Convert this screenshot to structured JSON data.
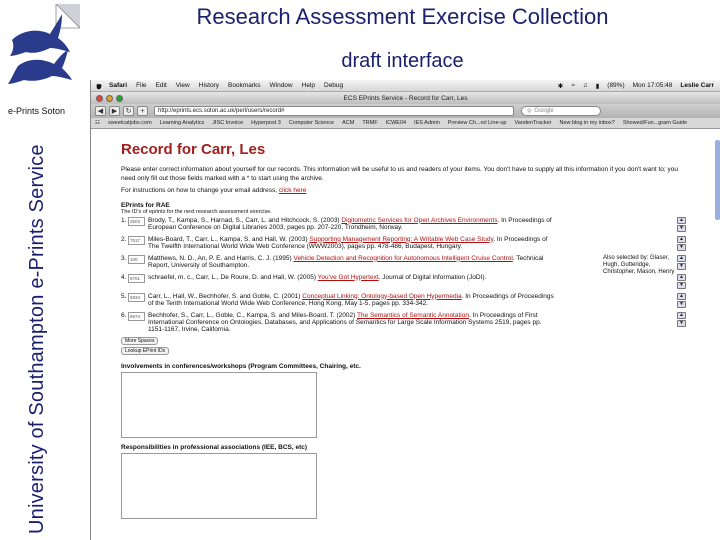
{
  "slide": {
    "title": "Research Assessment Exercise Collection",
    "subtitle": "draft interface",
    "brand_label": "e-Prints Soton",
    "vertical_text": "University of Southampton e-Prints Service"
  },
  "colors": {
    "title": "#1a1f6e",
    "record_heading": "#a0201e",
    "link": "#b01010"
  },
  "menubar": {
    "menus": [
      "Safari",
      "File",
      "Edit",
      "View",
      "History",
      "Bookmarks",
      "Window",
      "Help",
      "Debug"
    ],
    "battery": "(89%)",
    "clock": "Mon 17:05:48",
    "user": "Leslie Carr"
  },
  "browser": {
    "window_title": "ECS EPrints Service - Record for Carr, Les",
    "url": "http://eprints.ecs.soton.ac.uk/perl/users/record#",
    "search_placeholder": "Google",
    "bookmarks": [
      "sweetcatjobs.com",
      "Learning Analytics",
      "JISC Invoice",
      "Hyperpost 3",
      "Computer Science",
      "ACM",
      "TRMF",
      "ICWE04",
      "IES Admin",
      "Preview Ch...rol Line-up",
      "VandenTracker",
      "New blog in my inbox?",
      "Showed/Fun...gram Guide"
    ]
  },
  "page": {
    "heading": "Record for Carr, Les",
    "intro": "Please enter correct information about yourself for our records. This information will be useful to us and readers of your items. You don't have to supply all this information if you don't want to; you need only fill out those fields marked with a * to start using the archive.",
    "instructions_prefix": "For instructions on how to change your email address, ",
    "instructions_link": "click here",
    "eprints_heading": "EPrints for RAE",
    "eprints_subhead": "The ID's of eprints for the next research assessment exercise.",
    "eprints": [
      {
        "num": "1.",
        "id": "2503",
        "pre": "Brody, T., Kampa, S., Harnad, S., Carr, L. and Hitchcock, S. (2003) ",
        "link": "Digitometric Services for Open Archives Environments",
        "post": ". In Proceedings of European Conference on Digital Libraries 2003, pages pp. 207-220, Trondheim, Norway.",
        "extra": ""
      },
      {
        "num": "2.",
        "id": "7517",
        "pre": "Miles-Board, T., Carr, L., Kampa, S. and Hall, W. (2003) ",
        "link": "Supporting Management Reporting: A Writable Web Case Study",
        "post": ". In Proceedings of The Twelfth International World Wide Web Conference (WWW2003), pages pp. 478-486, Budapest, Hungary.",
        "extra": ""
      },
      {
        "num": "3.",
        "id": "100",
        "pre": "Matthews, N. D., An, P. E. and Harris, C. J. (1995) ",
        "link": "Vehicle Detection and Recognition for Autonomous Intelligent Cruise Control",
        "post": ". Technical Report, University of Southampton.",
        "extra": "Also selected by: Glaser, Hugh, Gutteridge, Christopher, Mason, Henry"
      },
      {
        "num": "4.",
        "id": "6701",
        "pre": "schraefel, m. c., Carr, L., De Roure, D. and Hall, W. (2005) ",
        "link": "You've Got Hypertext",
        "post": ". Journal of Digital Information (JoDI).",
        "extra": ""
      },
      {
        "num": "5.",
        "id": "5834",
        "pre": "Carr, L., Hall, W., Bechhofer, S. and Goble, C. (2001) ",
        "link": "Conceptual Linking: Ontology-based Open Hypermedia",
        "post": ". In Proceedings of Proceedings of the Tenth International World Wide Web Conference, Hong Kong, May 1-5, pages pp. 334-342.",
        "extra": ""
      },
      {
        "num": "6.",
        "id": "6874",
        "pre": "Bechhofer, S., Carr, L., Goble, C., Kampa, S. and Miles-Board, T. (2002) ",
        "link": "The Semantics of Semantic Annotation",
        "post": ". In Proceedings of First International Conference on Ontologies, Databases, and Applications of Semantics for Large Scale Information Systems 2519, pages pp. 1151-1167, Irvine, California.",
        "extra": ""
      }
    ],
    "more_spaces_btn": "More Spaces",
    "lookup_btn": "Lookup EPrint IDs",
    "involvements_label": "Involvements in conferences/workshops (Program Committees, Chairing, etc.",
    "responsibilities_label": "Responsibilities in professional associations (IEE, BCS, etc)"
  }
}
